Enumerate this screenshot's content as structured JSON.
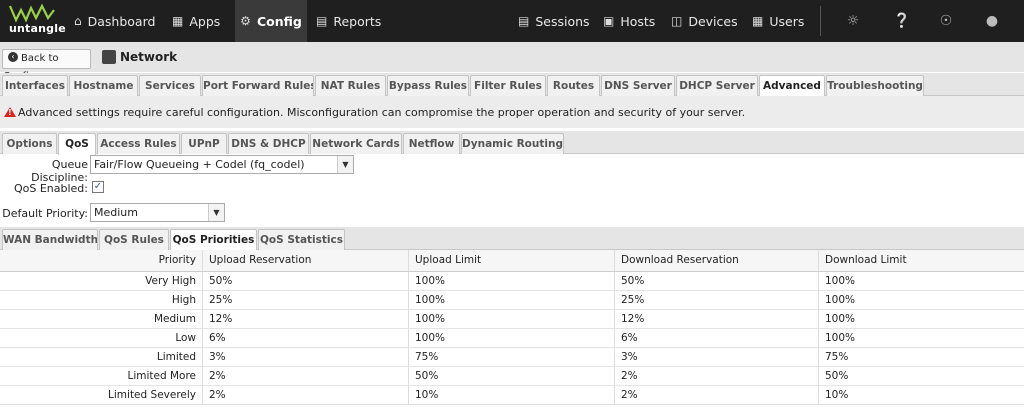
{
  "brand": {
    "name": "untangle"
  },
  "topnav": {
    "items": [
      {
        "label": "Dashboard",
        "icon": "home-icon"
      },
      {
        "label": "Apps",
        "icon": "apps-grid-icon"
      },
      {
        "label": "Config",
        "icon": "gear-icon",
        "active": true
      },
      {
        "label": "Reports",
        "icon": "chart-icon"
      }
    ],
    "right_items": [
      {
        "label": "Sessions",
        "icon": "sessions-icon"
      },
      {
        "label": "Hosts",
        "icon": "hosts-icon"
      },
      {
        "label": "Devices",
        "icon": "devices-icon"
      },
      {
        "label": "Users",
        "icon": "users-icon"
      }
    ],
    "utility_icons": [
      "lightbulb-icon",
      "help-icon",
      "support-icon",
      "account-icon"
    ]
  },
  "breadcrumb": {
    "back_label": "Back to Config",
    "title": "Network"
  },
  "main_tabs": [
    "Interfaces",
    "Hostname",
    "Services",
    "Port Forward Rules",
    "NAT Rules",
    "Bypass Rules",
    "Filter Rules",
    "Routes",
    "DNS Server",
    "DHCP Server",
    "Advanced",
    "Troubleshooting"
  ],
  "main_tab_active": "Advanced",
  "warning": {
    "text": "Advanced settings require careful configuration. Misconfiguration can compromise the proper operation and security of your server."
  },
  "sub_tabs": [
    "Options",
    "QoS",
    "Access Rules",
    "UPnP",
    "DNS & DHCP",
    "Network Cards",
    "Netflow",
    "Dynamic Routing"
  ],
  "sub_tab_active": "QoS",
  "qos_form": {
    "queue_discipline_label": "Queue Discipline:",
    "queue_discipline_value": "Fair/Flow Queueing + Codel (fq_codel)",
    "qos_enabled_label": "QoS Enabled:",
    "qos_enabled_checked": true,
    "default_priority_label": "Default Priority:",
    "default_priority_value": "Medium"
  },
  "qos_tabs": [
    "WAN Bandwidth",
    "QoS Rules",
    "QoS Priorities",
    "QoS Statistics"
  ],
  "qos_tab_active": "QoS Priorities",
  "table": {
    "headers": [
      "Priority",
      "Upload Reservation",
      "Upload Limit",
      "Download Reservation",
      "Download Limit"
    ],
    "rows": [
      [
        "Very High",
        "50%",
        "100%",
        "50%",
        "100%"
      ],
      [
        "High",
        "25%",
        "100%",
        "25%",
        "100%"
      ],
      [
        "Medium",
        "12%",
        "100%",
        "12%",
        "100%"
      ],
      [
        "Low",
        "6%",
        "100%",
        "6%",
        "100%"
      ],
      [
        "Limited",
        "3%",
        "75%",
        "3%",
        "75%"
      ],
      [
        "Limited More",
        "2%",
        "50%",
        "2%",
        "50%"
      ],
      [
        "Limited Severely",
        "2%",
        "10%",
        "2%",
        "10%"
      ]
    ]
  },
  "colors": {
    "topbar": "#1f1f1f",
    "warning_icon": "#d9241e",
    "logo_green": "#9bd04b"
  }
}
